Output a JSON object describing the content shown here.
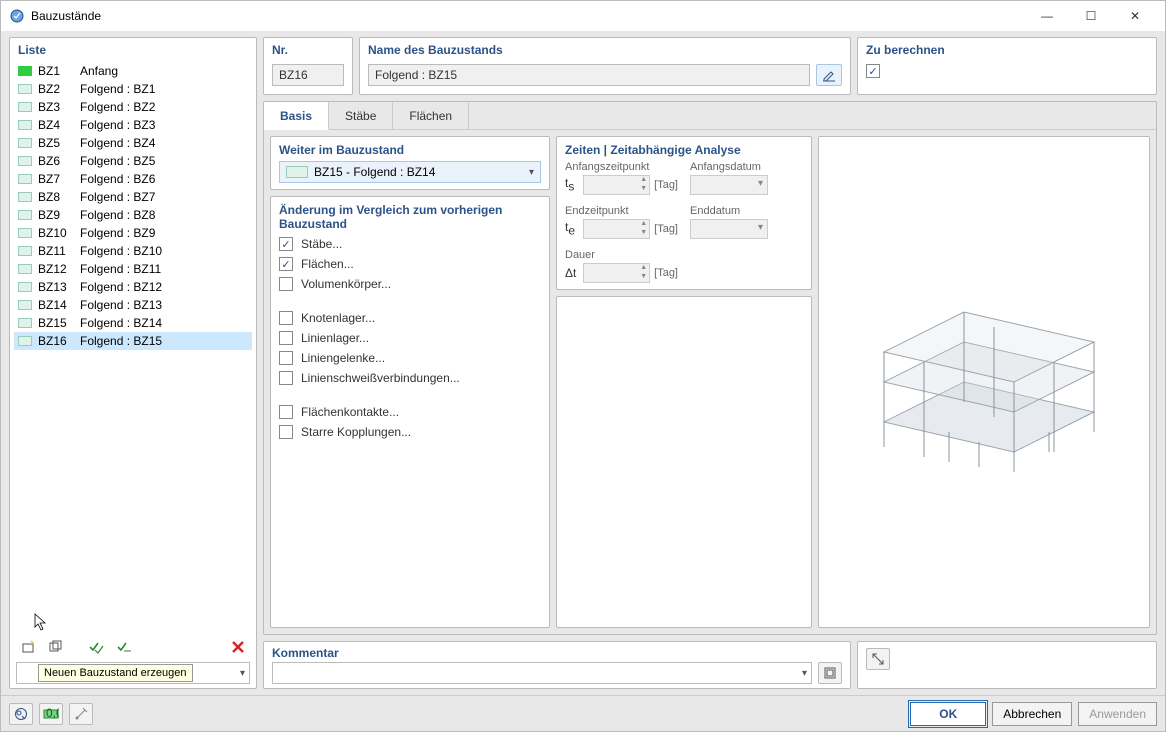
{
  "window": {
    "title": "Bauzustände"
  },
  "winbtns": {
    "min": "—",
    "max": "☐",
    "close": "✕"
  },
  "left": {
    "title": "Liste",
    "items": [
      {
        "code": "BZ1",
        "name": "Anfang",
        "green": true
      },
      {
        "code": "BZ2",
        "name": "Folgend : BZ1"
      },
      {
        "code": "BZ3",
        "name": "Folgend : BZ2"
      },
      {
        "code": "BZ4",
        "name": "Folgend : BZ3"
      },
      {
        "code": "BZ5",
        "name": "Folgend : BZ4"
      },
      {
        "code": "BZ6",
        "name": "Folgend : BZ5"
      },
      {
        "code": "BZ7",
        "name": "Folgend : BZ6"
      },
      {
        "code": "BZ8",
        "name": "Folgend : BZ7"
      },
      {
        "code": "BZ9",
        "name": "Folgend : BZ8"
      },
      {
        "code": "BZ10",
        "name": "Folgend : BZ9"
      },
      {
        "code": "BZ11",
        "name": "Folgend : BZ10"
      },
      {
        "code": "BZ12",
        "name": "Folgend : BZ11"
      },
      {
        "code": "BZ13",
        "name": "Folgend : BZ12"
      },
      {
        "code": "BZ14",
        "name": "Folgend : BZ13"
      },
      {
        "code": "BZ15",
        "name": "Folgend : BZ14"
      },
      {
        "code": "BZ16",
        "name": "Folgend : BZ15",
        "selected": true
      }
    ],
    "tooltip": "Neuen Bauzustand erzeugen"
  },
  "nr": {
    "title": "Nr.",
    "value": "BZ16"
  },
  "nameBox": {
    "title": "Name des Bauzustands",
    "value": "Folgend : BZ15"
  },
  "calc": {
    "title": "Zu berechnen"
  },
  "tabs": {
    "basis": "Basis",
    "staebe": "Stäbe",
    "flaechen": "Flächen"
  },
  "weiter": {
    "title": "Weiter im Bauzustand",
    "value": "BZ15 - Folgend : BZ14"
  },
  "aend": {
    "title": "Änderung im Vergleich zum vorherigen Bauzustand",
    "items": [
      {
        "label": "Stäbe...",
        "checked": true
      },
      {
        "label": "Flächen...",
        "checked": true
      },
      {
        "label": "Volumenkörper..."
      },
      {
        "gap": true
      },
      {
        "label": "Knotenlager..."
      },
      {
        "label": "Linienlager..."
      },
      {
        "label": "Liniengelenke..."
      },
      {
        "label": "Linienschweißverbindungen..."
      },
      {
        "gap": true
      },
      {
        "label": "Flächenkontakte..."
      },
      {
        "label": "Starre Kopplungen..."
      }
    ]
  },
  "zeiten": {
    "title": "Zeiten | Zeitabhängige Analyse",
    "anfz": "Anfangszeitpunkt",
    "anfd": "Anfangsdatum",
    "endz": "Endzeitpunkt",
    "endd": "Enddatum",
    "dauer": "Dauer",
    "ts": "t",
    "ts_sub": "s",
    "te": "t",
    "te_sub": "e",
    "dt": "Δt",
    "tag": "[Tag]"
  },
  "kommentar": {
    "title": "Kommentar"
  },
  "buttons": {
    "ok": "OK",
    "cancel": "Abbrechen",
    "apply": "Anwenden"
  }
}
